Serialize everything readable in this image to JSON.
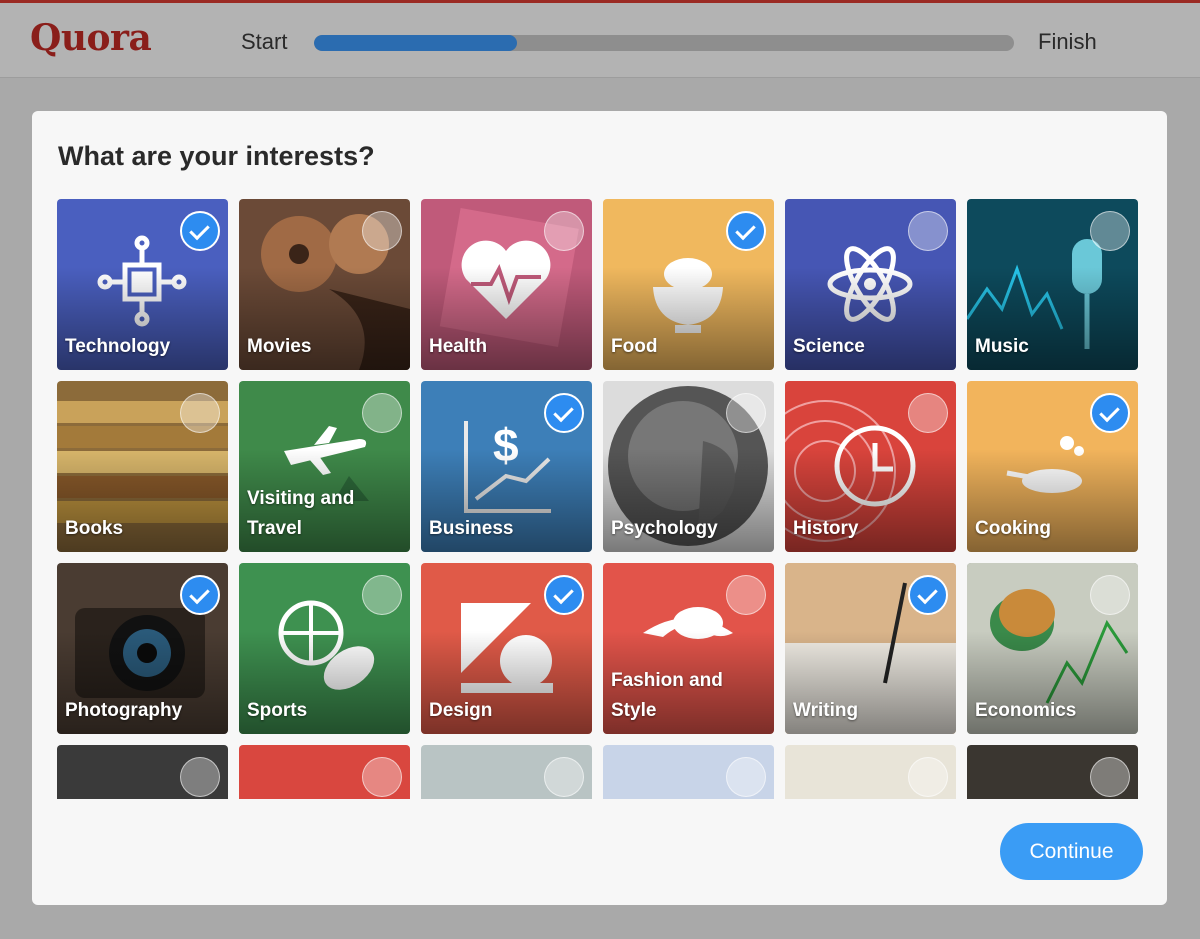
{
  "header": {
    "logo": "Quora",
    "progress_start": "Start",
    "progress_end": "Finish",
    "progress_fraction": 0.29,
    "accent_color": "#2b6cb0"
  },
  "main": {
    "title": "What are your interests?",
    "continue_label": "Continue",
    "topics": [
      {
        "label": "Technology",
        "selected": true,
        "bg": "#4a5fbf"
      },
      {
        "label": "Movies",
        "selected": false,
        "bg": "#6b4a37"
      },
      {
        "label": "Health",
        "selected": false,
        "bg": "#c05a7a"
      },
      {
        "label": "Food",
        "selected": true,
        "bg": "#f0b85e"
      },
      {
        "label": "Science",
        "selected": false,
        "bg": "#4656b4"
      },
      {
        "label": "Music",
        "selected": false,
        "bg": "#0d4a5c"
      },
      {
        "label": "Books",
        "selected": false,
        "bg": "#8c6b3a"
      },
      {
        "label": "Visiting and Travel",
        "selected": false,
        "bg": "#3f8a4a"
      },
      {
        "label": "Business",
        "selected": true,
        "bg": "#3d7fb8"
      },
      {
        "label": "Psychology",
        "selected": false,
        "bg": "#dcdcdc"
      },
      {
        "label": "History",
        "selected": false,
        "bg": "#d9443c"
      },
      {
        "label": "Cooking",
        "selected": true,
        "bg": "#f2b45c"
      },
      {
        "label": "Photography",
        "selected": true,
        "bg": "#4a3c32"
      },
      {
        "label": "Sports",
        "selected": false,
        "bg": "#3e9150"
      },
      {
        "label": "Design",
        "selected": true,
        "bg": "#e05a48"
      },
      {
        "label": "Fashion and Style",
        "selected": false,
        "bg": "#e2544a"
      },
      {
        "label": "Writing",
        "selected": true,
        "bg": "#c79a6a"
      },
      {
        "label": "Economics",
        "selected": false,
        "bg": "#7a8a7a"
      },
      {
        "label": "",
        "selected": false,
        "bg": "#3a3a3a"
      },
      {
        "label": "",
        "selected": false,
        "bg": "#d9473f"
      },
      {
        "label": "",
        "selected": false,
        "bg": "#b9c4c4"
      },
      {
        "label": "",
        "selected": false,
        "bg": "#c8d4e8"
      },
      {
        "label": "",
        "selected": false,
        "bg": "#e8e4d8"
      },
      {
        "label": "",
        "selected": false,
        "bg": "#3a3630"
      }
    ]
  }
}
